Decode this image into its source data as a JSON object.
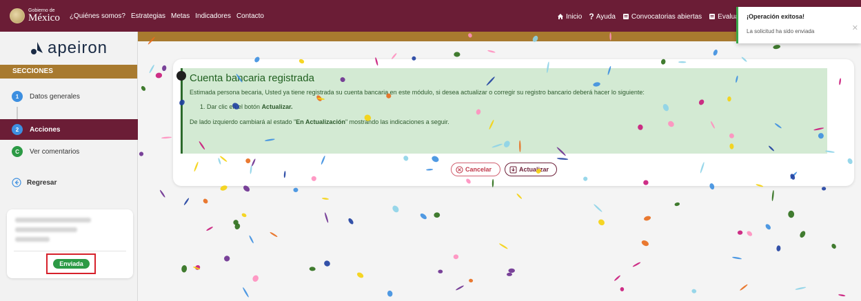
{
  "header": {
    "gov_small": "Gobierno de",
    "gov_big": "México",
    "nav": [
      "¿Quiénes somos?",
      "Estrategias",
      "Metas",
      "Indicadores",
      "Contacto"
    ],
    "right_nav": {
      "home": "Inicio",
      "help": "Ayuda",
      "calls": "Convocatorias abiertas",
      "evaluation": "Evaluac"
    }
  },
  "sidebar": {
    "brand": "apeiron",
    "sections_title": "SECCIONES",
    "items": [
      {
        "badge": "1",
        "label": "Datos generales",
        "color": "#3d8fe0"
      },
      {
        "badge": "2",
        "label": "Acciones",
        "color": "#3d8fe0"
      },
      {
        "badge": "C",
        "label": "Ver comentarios",
        "color": "#2c9a45"
      }
    ],
    "back": "Regresar",
    "status": "Enviada"
  },
  "main": {
    "alert_title": "Cuenta bancaria registrada",
    "alert_body": "Estimada persona becaria, Usted ya tiene registrada su cuenta bancaria en este módulo, si desea actualizar o corregir su registro bancario deberá hacer lo siguiente:",
    "step_prefix": "1. Dar clic en el botón",
    "step_bold": "Actualizar.",
    "note_prefix": "De lado izquierdo cambiará al estado \"",
    "note_bold": "En Actualización",
    "note_suffix": "\" mostrando las indicaciones a seguir.",
    "cancel_label": "Cancelar",
    "update_label": "Actualizar"
  },
  "toast": {
    "title": "¡Operación exitosa!",
    "message": "La solicitud ha sido enviada"
  },
  "colors": {
    "primary": "#6b1d36",
    "gold": "#a87a2f",
    "success": "#2c9a45",
    "alert_bg": "#d3ead3",
    "confetti": [
      "#3d8fe0",
      "#f5d10d",
      "#ff8fbf",
      "#2c6e1a",
      "#6b2f8f",
      "#e86b1c",
      "#8dd3e8",
      "#c9187a",
      "#1e3fa0"
    ]
  }
}
